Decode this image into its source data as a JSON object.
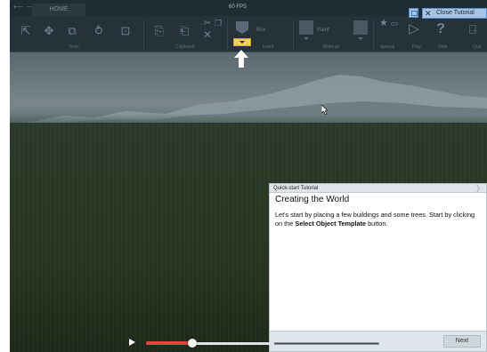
{
  "window": {
    "tab_home": "HOME",
    "fps": "60 FPS"
  },
  "toolbar": {
    "groups": {
      "tools": "Tools",
      "clipboard": "Clipboard",
      "insert": "Insert",
      "material": "Material",
      "special": "Special",
      "play": "Play",
      "help": "Help",
      "quit": "Quit"
    },
    "box_label": "Box",
    "paint_label": "Paint"
  },
  "tutorial_controls": {
    "close_label": "Close Tutorial"
  },
  "tutorial": {
    "header": "Quick-start Tutorial",
    "title": "Creating the World",
    "text_before": "Let's start by placing a few buildings and some trees. Start by clicking on the ",
    "text_bold": "Select Object Template",
    "text_after": " button.",
    "next_label": "Next"
  },
  "player": {
    "progress_played": 0.2,
    "progress_buffered": 0.55
  },
  "colors": {
    "accent": "#f2d24c",
    "progress": "#e8423d",
    "close_button": "#a7c4e2"
  }
}
